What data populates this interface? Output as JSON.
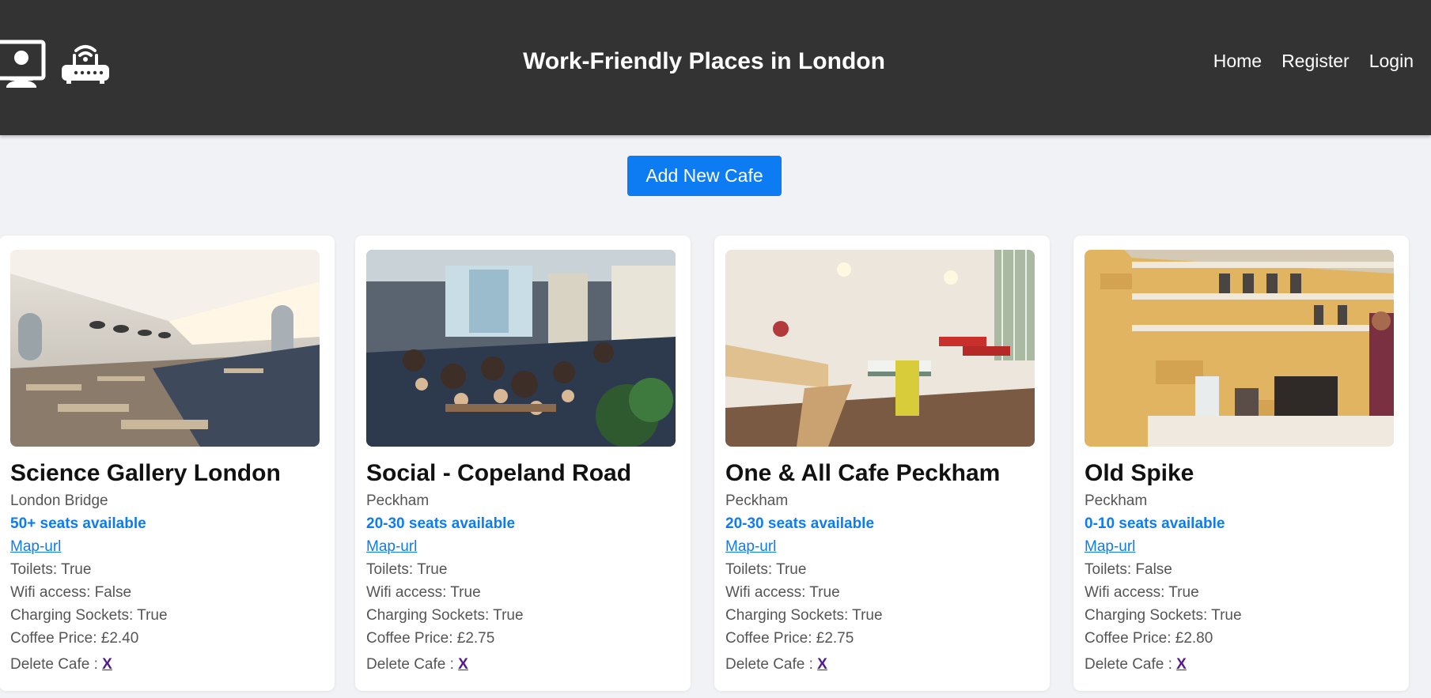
{
  "header": {
    "title": "Work-Friendly Places in London",
    "logo_icons": [
      "remote-worker-icon",
      "wifi-router-icon"
    ],
    "nav": [
      {
        "label": "Home"
      },
      {
        "label": "Register"
      },
      {
        "label": "Login"
      }
    ],
    "bg_color": "#333333"
  },
  "actions": {
    "add_label": "Add New Cafe",
    "accent_color": "#0d7cf2"
  },
  "cafes": [
    {
      "name": "Science Gallery London",
      "location": "London Bridge",
      "seats": "50+ seats available",
      "map_label": "Map-url",
      "toilets": "Toilets: True",
      "wifi": "Wifi access: False",
      "sockets": "Charging Sockets: True",
      "price": "Coffee Price: £2.40",
      "delete_label": "Delete Cafe : ",
      "delete_link": "X"
    },
    {
      "name": "Social - Copeland Road",
      "location": "Peckham",
      "seats": "20-30 seats available",
      "map_label": "Map-url",
      "toilets": "Toilets: True",
      "wifi": "Wifi access: True",
      "sockets": "Charging Sockets: True",
      "price": "Coffee Price: £2.75",
      "delete_label": "Delete Cafe : ",
      "delete_link": "X"
    },
    {
      "name": "One & All Cafe Peckham",
      "location": "Peckham",
      "seats": "20-30 seats available",
      "map_label": "Map-url",
      "toilets": "Toilets: True",
      "wifi": "Wifi access: True",
      "sockets": "Charging Sockets: True",
      "price": "Coffee Price: £2.75",
      "delete_label": "Delete Cafe : ",
      "delete_link": "X"
    },
    {
      "name": "Old Spike",
      "location": "Peckham",
      "seats": "0-10 seats available",
      "map_label": "Map-url",
      "toilets": "Toilets: False",
      "wifi": "Wifi access: True",
      "sockets": "Charging Sockets: True",
      "price": "Coffee Price: £2.80",
      "delete_label": "Delete Cafe : ",
      "delete_link": "X"
    }
  ]
}
